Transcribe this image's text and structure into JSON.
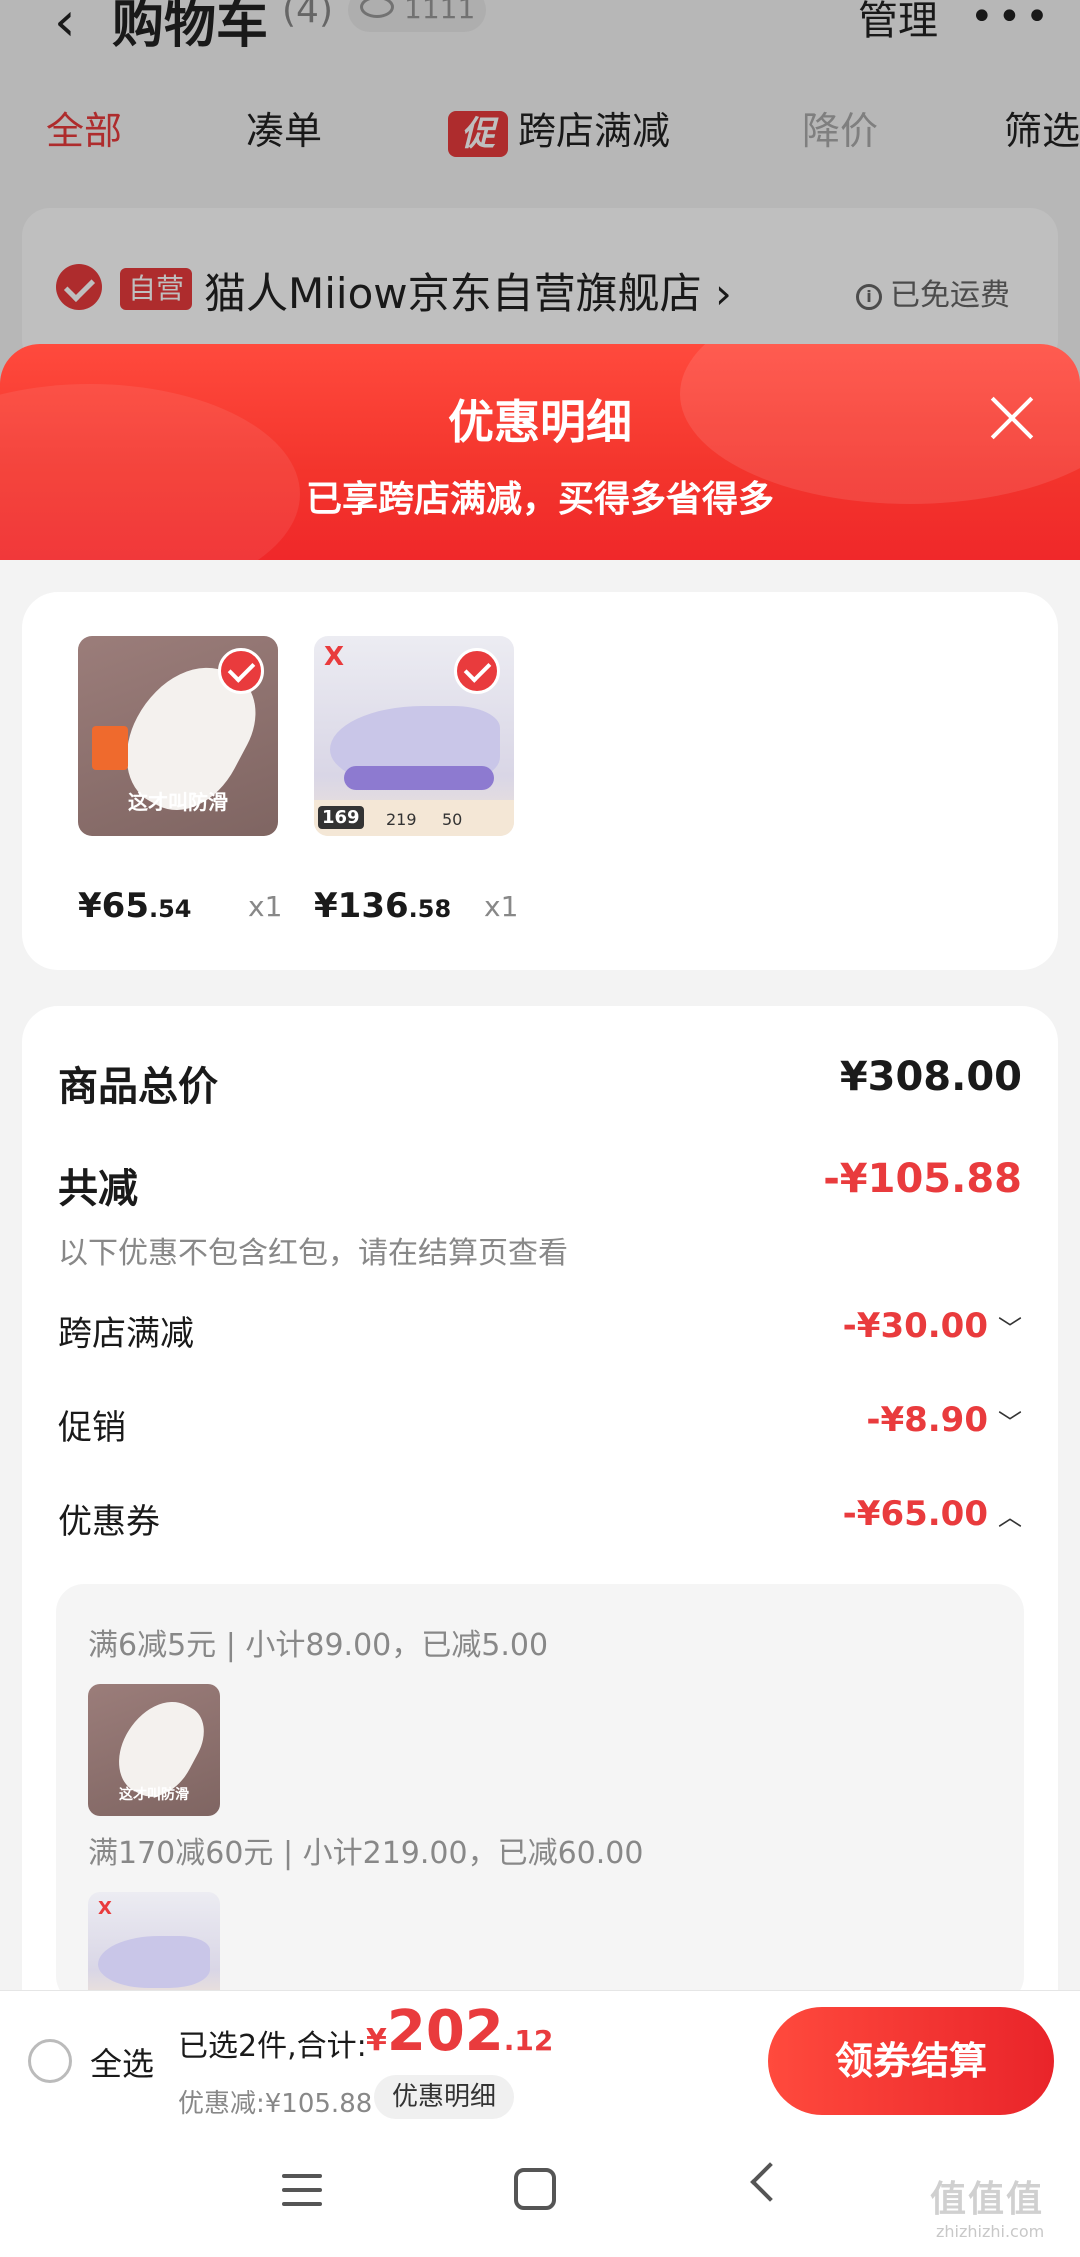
{
  "topbar": {
    "back_icon": "chevron-left-icon",
    "title": "购物车",
    "count": "(4)",
    "views": "1111",
    "manage_label": "管理",
    "more_icon": "more-dots-icon"
  },
  "tabs": [
    {
      "label": "全部"
    },
    {
      "label": "凑单"
    },
    {
      "badge": "促",
      "label": "跨店满减"
    },
    {
      "label": "降价"
    },
    {
      "label": "筛选"
    }
  ],
  "store": {
    "badge": "自营",
    "name": "猫人Miiow京东自营旗舰店 ›",
    "shipping": "已免运费"
  },
  "sheet": {
    "title": "优惠明细",
    "subtitle": "已享跨店满减，买得多省得多",
    "close_icon": "close-icon"
  },
  "products": [
    {
      "price_int": "¥65",
      "price_dec": ".54",
      "qty": "x1",
      "image_text": "这才叫防滑"
    },
    {
      "price_int": "¥136",
      "price_dec": ".58",
      "qty": "x1",
      "image_price": "169",
      "image_n1": "219",
      "image_n2": "50"
    }
  ],
  "summary": {
    "total_label": "商品总价",
    "total_value": "¥308.00",
    "reduce_label": "共减",
    "reduce_value": "-¥105.88",
    "reduce_note": "以下优惠不包含红包，请在结算页查看",
    "items": [
      {
        "label": "跨店满减",
        "value": "-¥30.00",
        "chevron": "﹀"
      },
      {
        "label": "促销",
        "value": "-¥8.90",
        "chevron": "﹀"
      },
      {
        "label": "优惠券",
        "value": "-¥65.00",
        "chevron": "︿"
      }
    ],
    "coupons": [
      {
        "text": "满6减5元 | 小计89.00，已减5.00",
        "image_text": "这才叫防滑"
      },
      {
        "text": "满170减60元 | 小计219.00，已减60.00"
      }
    ]
  },
  "bottom": {
    "select_all": "全选",
    "selected_text": "已选2件,合计:",
    "total_cur": "¥",
    "total_int": "202",
    "total_dec": ".12",
    "discount_text": "优惠减:¥105.88",
    "detail_chip": "优惠明细",
    "checkout": "领券结算"
  },
  "watermark": {
    "text": "值值值",
    "sub": "zhizhizhi.com"
  },
  "colors": {
    "accent": "#e93b3d",
    "header_gradient_start": "#ff4a3d",
    "header_gradient_end": "#f0282a"
  }
}
